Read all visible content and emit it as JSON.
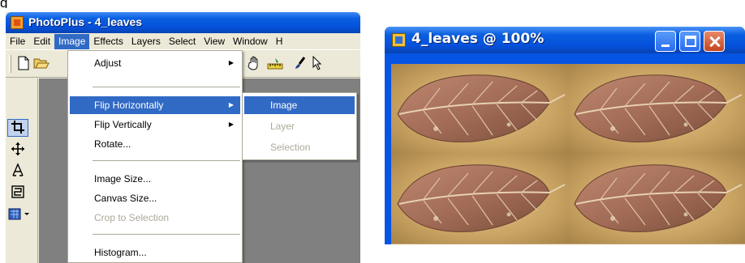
{
  "corner_fragment": "g",
  "app": {
    "title": "PhotoPlus - 4_leaves",
    "icon": "photoplus-app-icon",
    "menu": [
      "File",
      "Edit",
      "Image",
      "Effects",
      "Layers",
      "Select",
      "View",
      "Window",
      "H"
    ],
    "active_menu": "Image"
  },
  "toolbar": {
    "icons": [
      "new-document-icon",
      "open-folder-icon",
      "hand-pan-icon",
      "ruler-icon",
      "brush-icon",
      "pointer-icon"
    ]
  },
  "left_panel": {
    "icons": [
      "crop-tool-icon",
      "move-tool-icon",
      "text-tool-icon",
      "shape-tool-icon",
      "fill-tool-icon"
    ]
  },
  "image_menu": {
    "items": [
      {
        "label": "Adjust",
        "submenu": true
      },
      {
        "label": "Flip Horizontally",
        "submenu": true,
        "highlighted": true
      },
      {
        "label": "Flip Vertically",
        "submenu": true
      },
      {
        "label": "Rotate..."
      },
      {
        "label": "Image Size..."
      },
      {
        "label": "Canvas Size..."
      },
      {
        "label": "Crop to Selection",
        "disabled": true
      },
      {
        "label": "Histogram..."
      }
    ]
  },
  "flip_submenu": {
    "items": [
      {
        "label": "Image",
        "highlighted": true
      },
      {
        "label": "Layer",
        "disabled": true
      },
      {
        "label": "Selection",
        "disabled": true
      }
    ]
  },
  "document": {
    "title": "4_leaves @ 100%",
    "icon": "image-document-icon",
    "controls": [
      "minimize-button",
      "maximize-button",
      "close-button"
    ],
    "colors": {
      "title_bar": "#0551dc",
      "leaf": "#a86a4a",
      "background": "#c8a46a"
    }
  }
}
